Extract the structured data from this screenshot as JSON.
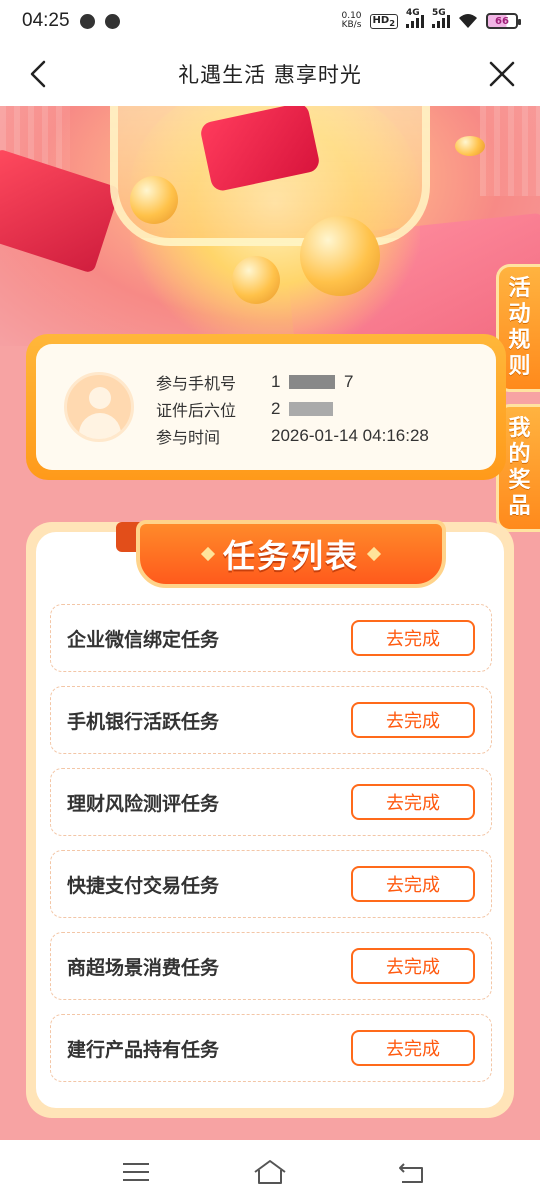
{
  "status_bar": {
    "time": "04:25",
    "net_speed_value": "0.10",
    "net_speed_unit": "KB/s",
    "hd_label": "HD",
    "hd_sub": "2",
    "signal_1_label": "4G",
    "signal_2_label": "5G",
    "battery": "66"
  },
  "nav": {
    "title": "礼遇生活 惠享时光"
  },
  "side_tabs": {
    "rules": [
      "活",
      "动",
      "规",
      "则"
    ],
    "prizes": [
      "我",
      "的",
      "奖",
      "品"
    ]
  },
  "info_card": {
    "phone_label": "参与手机号",
    "phone_value_prefix": "1",
    "phone_value_suffix": "7",
    "id_label": "证件后六位",
    "id_value_prefix": "2",
    "time_label": "参与时间",
    "time_value": "2026-01-14 04:16:28"
  },
  "task_panel": {
    "title": "任务列表",
    "tasks": [
      {
        "name": "企业微信绑定任务",
        "button": "去完成"
      },
      {
        "name": "手机银行活跃任务",
        "button": "去完成"
      },
      {
        "name": "理财风险测评任务",
        "button": "去完成"
      },
      {
        "name": "快捷支付交易任务",
        "button": "去完成"
      },
      {
        "name": "商超场景消费任务",
        "button": "去完成"
      },
      {
        "name": "建行产品持有任务",
        "button": "去完成"
      }
    ]
  },
  "colors": {
    "accent_orange": "#ff6a1a",
    "page_pink": "#f7a3a3",
    "card_gold": "#ffa826"
  }
}
